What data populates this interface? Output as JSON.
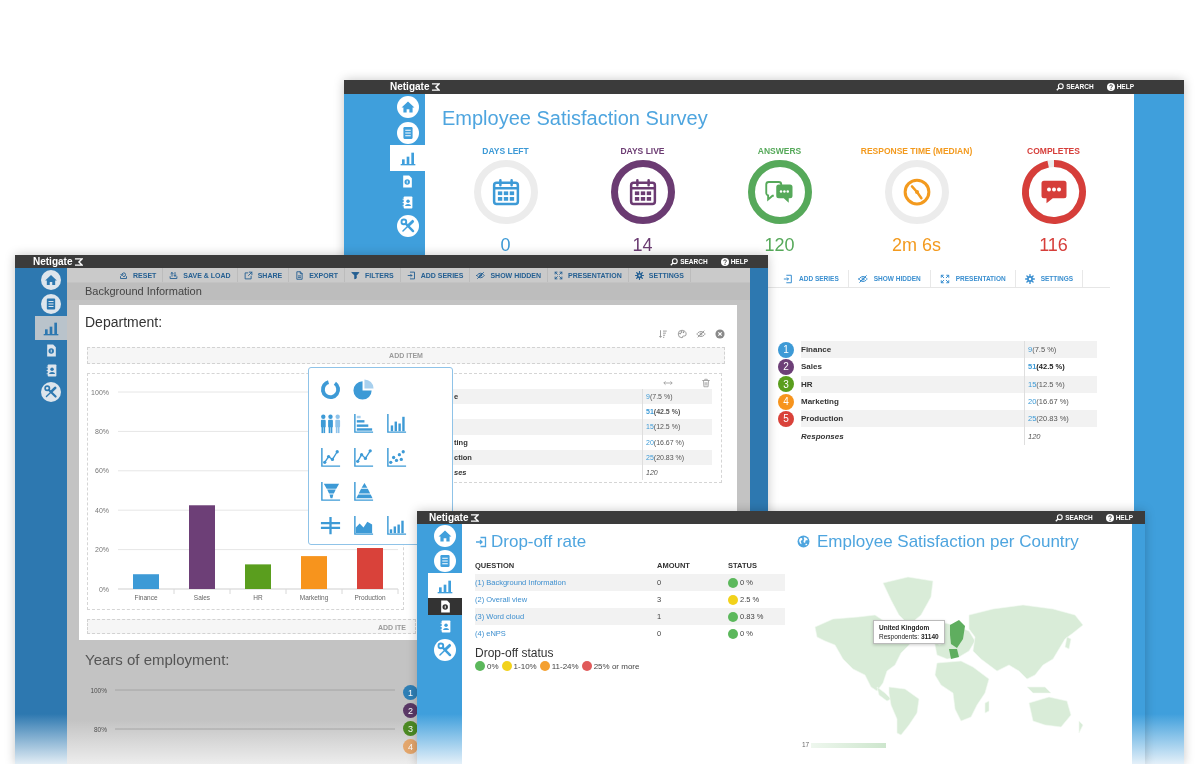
{
  "survey_window": {
    "header": {
      "logo": "Netigate",
      "search": "SEARCH",
      "help": "HELP"
    },
    "nav": [
      {
        "kind": "home",
        "selected": false
      },
      {
        "kind": "surveys",
        "selected": false
      },
      {
        "kind": "reports",
        "selected": true
      },
      {
        "kind": "page",
        "selected": false
      },
      {
        "kind": "contacts",
        "selected": false
      },
      {
        "kind": "tools",
        "selected": false
      }
    ],
    "title": "Employee Satisfaction Survey",
    "kpis": [
      {
        "kind": "calendar",
        "label": "DAYS LEFT",
        "value": "0",
        "color": "#3d9ad6",
        "level": 0
      },
      {
        "kind": "calendar",
        "label": "DAYS LIVE",
        "value": "14",
        "color": "#6b3b72",
        "level": 1
      },
      {
        "kind": "chat",
        "label": "ANSWERS",
        "value": "120",
        "color": "#56a95a",
        "level": 1
      },
      {
        "kind": "clock",
        "label": "RESPONSE TIME (MEDIAN)",
        "value": "2m 6s",
        "color": "#f39a1e"
      },
      {
        "kind": "message",
        "label": "COMPLETES",
        "value": "116",
        "color": "#d63e3a",
        "level": 0.967
      }
    ],
    "toolbar": [
      {
        "kind": "series",
        "label": "ADD SERIES"
      },
      {
        "kind": "hidden",
        "label": "SHOW HIDDEN"
      },
      {
        "kind": "presentation",
        "label": "PRESENTATION"
      },
      {
        "kind": "settings",
        "label": "SETTINGS"
      }
    ],
    "legend": {
      "rows": [
        {
          "number": "1",
          "name": "Finance",
          "color": "#3d9ad6",
          "count": "9",
          "share": "(7.5 %)",
          "emphasized": false
        },
        {
          "number": "2",
          "name": "Sales",
          "color": "#6d3f77",
          "count": "51",
          "share": "(42.5 %)",
          "emphasized": true
        },
        {
          "number": "3",
          "name": "HR",
          "color": "#5a9e1e",
          "count": "15",
          "share": "(12.5 %)",
          "emphasized": false
        },
        {
          "number": "4",
          "name": "Marketing",
          "color": "#f7941d",
          "count": "20",
          "share": "(16.67 %)",
          "emphasized": false
        },
        {
          "number": "5",
          "name": "Production",
          "color": "#d9423a",
          "count": "25",
          "share": "(20.83 %)",
          "emphasized": false
        }
      ],
      "total": {
        "label": "Responses",
        "value": "120"
      }
    }
  },
  "editor_window": {
    "header": {
      "logo": "Netigate",
      "search": "SEARCH",
      "help": "HELP"
    },
    "nav": [
      {
        "kind": "home",
        "selected": false
      },
      {
        "kind": "surveys",
        "selected": false
      },
      {
        "kind": "reports",
        "selected": true
      },
      {
        "kind": "page",
        "selected": false
      },
      {
        "kind": "contacts",
        "selected": false
      },
      {
        "kind": "tools",
        "selected": false
      }
    ],
    "toolbar": [
      {
        "kind": "reset",
        "label": "RESET"
      },
      {
        "kind": "save",
        "label": "SAVE & LOAD"
      },
      {
        "kind": "share",
        "label": "SHARE"
      },
      {
        "kind": "export",
        "label": "EXPORT"
      },
      {
        "kind": "filter",
        "label": "FILTERS"
      },
      {
        "kind": "series",
        "label": "ADD SERIES"
      },
      {
        "kind": "hidden",
        "label": "SHOW HIDDEN"
      },
      {
        "kind": "presentation",
        "label": "PRESENTATION"
      },
      {
        "kind": "settings",
        "label": "SETTINGS"
      }
    ],
    "section": "Background Information",
    "card": {
      "title": "Department:",
      "add_item": "ADD ITEM",
      "add_item_bottom": "ADD ITE",
      "chart_data": {
        "type": "bar",
        "categories": [
          "Finance",
          "Sales",
          "HR",
          "Marketing",
          "Production"
        ],
        "values": [
          7.5,
          42.5,
          12.5,
          16.7,
          20.8
        ],
        "colors": [
          "#3d9ad6",
          "#6d3f77",
          "#5a9e1e",
          "#f7941d",
          "#d9423a"
        ],
        "grid": true,
        "ylim": [
          0,
          100
        ],
        "yticks": [
          {
            "value": 0,
            "label": "0%"
          },
          {
            "value": 20,
            "label": "20%"
          },
          {
            "value": 40,
            "label": "40%"
          },
          {
            "value": 60,
            "label": "60%"
          },
          {
            "value": 80,
            "label": "80%"
          },
          {
            "value": 100,
            "label": "100%"
          }
        ]
      },
      "table": {
        "rows": [
          {
            "name": "e",
            "count": "9",
            "share": "(7.5 %)",
            "emphasized": false
          },
          {
            "count": "51",
            "share": "(42.5 %)",
            "emphasized": true
          },
          {
            "count": "15",
            "share": "(12.5 %)",
            "emphasized": false
          },
          {
            "name": "ting",
            "count": "20",
            "share": "(16.67 %)",
            "emphasized": false
          },
          {
            "name": "ction",
            "count": "25",
            "share": "(20.83 %)",
            "emphasized": false
          }
        ],
        "total": {
          "label": "ses",
          "value": "120"
        }
      }
    },
    "years": {
      "title": "Years of employment:",
      "ticks": [
        "100%",
        "80%"
      ],
      "legend": [
        {
          "number": "1",
          "color": "#2f7fb5"
        },
        {
          "number": "2",
          "color": "#5a3866"
        },
        {
          "number": "3",
          "color": "#4c8a24"
        },
        {
          "number": "4",
          "color": "#e3a66c"
        }
      ]
    }
  },
  "dropoff_window": {
    "header": {
      "logo": "Netigate",
      "search": "SEARCH",
      "help": "HELP"
    },
    "nav": [
      {
        "kind": "home",
        "selected": false,
        "highlighted": false
      },
      {
        "kind": "surveys",
        "selected": false,
        "highlighted": false
      },
      {
        "kind": "reports",
        "selected": true,
        "highlighted": false
      },
      {
        "kind": "page",
        "selected": false,
        "highlighted": true
      },
      {
        "kind": "contacts",
        "selected": false,
        "highlighted": false
      },
      {
        "kind": "tools",
        "selected": false,
        "highlighted": false
      }
    ],
    "title": "Drop-off rate",
    "columns": [
      "QUESTION",
      "AMOUNT",
      "STATUS"
    ],
    "rows": [
      {
        "question": "(1) Background Information",
        "amount": "0",
        "status": "0 %",
        "color": "#5cb85c"
      },
      {
        "question": "(2) Overall view",
        "amount": "3",
        "status": "2.5 %",
        "color": "#f2d21b"
      },
      {
        "question": "(3) Word cloud",
        "amount": "1",
        "status": "0.83 %",
        "color": "#5cb85c"
      },
      {
        "question": "(4) eNPS",
        "amount": "0",
        "status": "0 %",
        "color": "#5cb85c"
      }
    ],
    "status_legend": {
      "title": "Drop-off status",
      "items": [
        {
          "label": "0%",
          "color": "#5cb85c"
        },
        {
          "label": "1-10%",
          "color": "#f2d21b"
        },
        {
          "label": "11-24%",
          "color": "#f4a030"
        },
        {
          "label": "25% or more",
          "color": "#e05a5a"
        }
      ]
    },
    "map": {
      "title": "Employee Satisfaction per Country",
      "tooltip": {
        "country": "United Kingdom",
        "detail": "Respondents: **31140**"
      },
      "scale_min": "17"
    }
  }
}
